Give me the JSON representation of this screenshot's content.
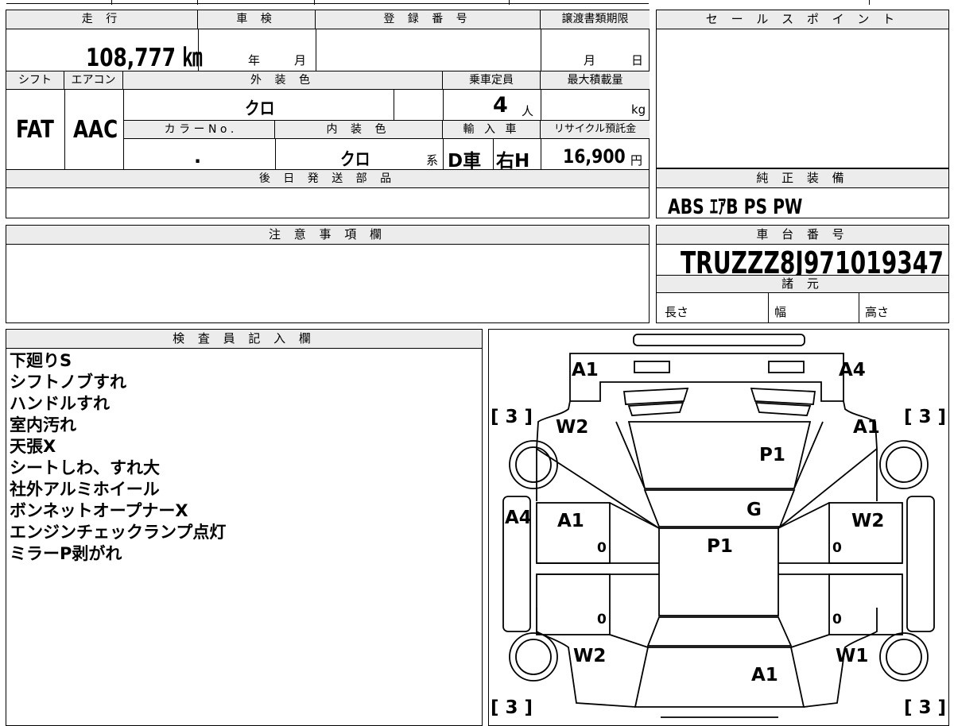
{
  "top_table": {
    "mileage_header": "走 行",
    "mileage_value": "108,777 ㎞",
    "shaken_header": "車 検",
    "shaken_year": "年",
    "shaken_month": "月",
    "reg_header": "登 録 番 号",
    "deadline_header": "譲渡書類期限",
    "deadline_month": "月",
    "deadline_day": "日",
    "shift_header": "シフト",
    "ac_header": "エアコン",
    "ext_color_header": "外 装 色",
    "capacity_header": "乗車定員",
    "max_load_header": "最大積載量",
    "shift_value": "FAT",
    "ac_value": "AAC",
    "ext_color_value": "クロ",
    "capacity_value": "4",
    "capacity_unit": "人",
    "max_load_unit": "kg",
    "color_no_header": "カ ラ ー N o .",
    "int_color_header": "内 装 色",
    "import_header": "輸 入 車",
    "recycle_header": "リサイクル預託金",
    "color_no_value": ".",
    "int_color_value": "クロ",
    "int_color_suffix": "系",
    "import_value_1": "D車",
    "import_value_2": "右H",
    "recycle_value": "16,900",
    "recycle_unit": "円",
    "later_parts_header": "後 日 発 送 部 品"
  },
  "sales_point": {
    "header": "セ ー ル ス ポ イ ン ト"
  },
  "genuine_equipment": {
    "header": "純 正 装 備",
    "value": "ABS ｴｱB PS PW"
  },
  "notes_section": {
    "header": "注 意 事 項 欄"
  },
  "chassis": {
    "header": "車 台 番 号",
    "value": "TRUZZZ8J971019347",
    "specs_header": "諸 元",
    "length_label": "長さ",
    "width_label": "幅",
    "height_label": "高さ"
  },
  "inspector": {
    "header": "検 査 員 記 入 欄",
    "lines": [
      "下廻りS",
      "シフトノブすれ",
      "ハンドルすれ",
      "室内汚れ",
      "天張X",
      "シートしわ、すれ大",
      "社外アルミホイール",
      "ボンネットオープナーX",
      "エンジンチェックランプ点灯",
      "ミラーP剥がれ"
    ]
  },
  "diagram": {
    "marks": [
      {
        "id": "front-left",
        "text": "A1"
      },
      {
        "id": "front-right",
        "text": "A4"
      },
      {
        "id": "tire-fl",
        "text": "[ 3 ]"
      },
      {
        "id": "tire-fr",
        "text": "[ 3 ]"
      },
      {
        "id": "fender-fl",
        "text": "W2"
      },
      {
        "id": "fender-fr",
        "text": "A1"
      },
      {
        "id": "hood",
        "text": "P1"
      },
      {
        "id": "side-left",
        "text": "A4"
      },
      {
        "id": "door-fl",
        "text": "A1"
      },
      {
        "id": "windshield",
        "text": "G"
      },
      {
        "id": "door-fr",
        "text": "W2"
      },
      {
        "id": "roof",
        "text": "P1"
      },
      {
        "id": "fender-rl",
        "text": "W2"
      },
      {
        "id": "fender-rr",
        "text": "W1"
      },
      {
        "id": "rear",
        "text": "A1"
      },
      {
        "id": "tire-rl",
        "text": "[ 3 ]"
      },
      {
        "id": "tire-rr",
        "text": "[ 3 ]"
      },
      {
        "id": "door-fl-zero",
        "text": "0"
      },
      {
        "id": "door-fr-zero",
        "text": "0"
      },
      {
        "id": "door-rl-zero",
        "text": "0"
      },
      {
        "id": "door-rr-zero",
        "text": "0"
      }
    ]
  }
}
